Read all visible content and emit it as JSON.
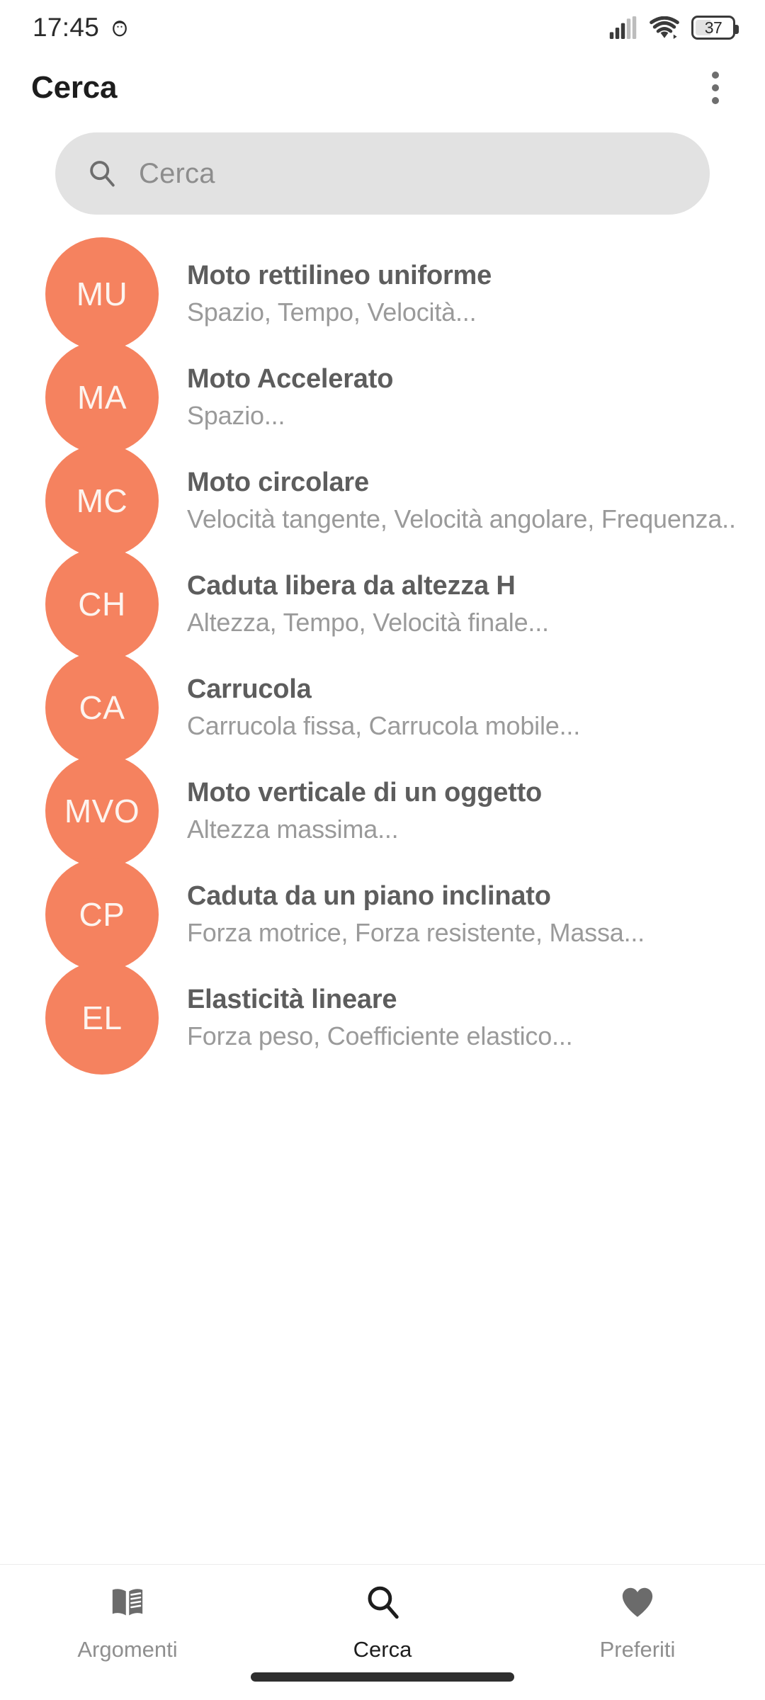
{
  "status_bar": {
    "time": "17:45",
    "alarm_icon": "alarm-icon",
    "signal_icon": "cellular-signal-icon",
    "wifi_icon": "wifi-icon",
    "battery_icon": "battery-icon",
    "battery_level": "37"
  },
  "app_bar": {
    "title": "Cerca",
    "overflow_icon": "more-vertical-icon"
  },
  "search": {
    "icon": "search-icon",
    "placeholder": "Cerca",
    "value": ""
  },
  "colors": {
    "avatar": "#F5825F",
    "search_background": "#E2E2E2",
    "title_text": "#5D5D5D",
    "subtitle_text": "#9A9A9A",
    "active_nav": "#1D1D1D",
    "inactive_nav": "#8F8F8F"
  },
  "list": {
    "items": [
      {
        "initials": "MU",
        "title": "Moto rettilineo uniforme",
        "subtitle": "Spazio, Tempo, Velocità..."
      },
      {
        "initials": "MA",
        "title": "Moto Accelerato",
        "subtitle": "Spazio..."
      },
      {
        "initials": "MC",
        "title": "Moto circolare",
        "subtitle": "Velocità tangente, Velocità angolare, Frequenza..."
      },
      {
        "initials": "CH",
        "title": "Caduta libera da altezza H",
        "subtitle": "Altezza, Tempo, Velocità finale..."
      },
      {
        "initials": "CA",
        "title": "Carrucola",
        "subtitle": "Carrucola fissa, Carrucola mobile..."
      },
      {
        "initials": "MVO",
        "title": "Moto verticale di un oggetto",
        "subtitle": "Altezza massima..."
      },
      {
        "initials": "CP",
        "title": "Caduta da un piano inclinato",
        "subtitle": "Forza motrice, Forza resistente, Massa..."
      },
      {
        "initials": "EL",
        "title": "Elasticità lineare",
        "subtitle": "Forza peso, Coefficiente elastico..."
      }
    ]
  },
  "bottom_nav": {
    "items": [
      {
        "label": "Argomenti",
        "icon": "book-icon",
        "active": false
      },
      {
        "label": "Cerca",
        "icon": "search-icon",
        "active": true
      },
      {
        "label": "Preferiti",
        "icon": "heart-icon",
        "active": false
      }
    ]
  }
}
